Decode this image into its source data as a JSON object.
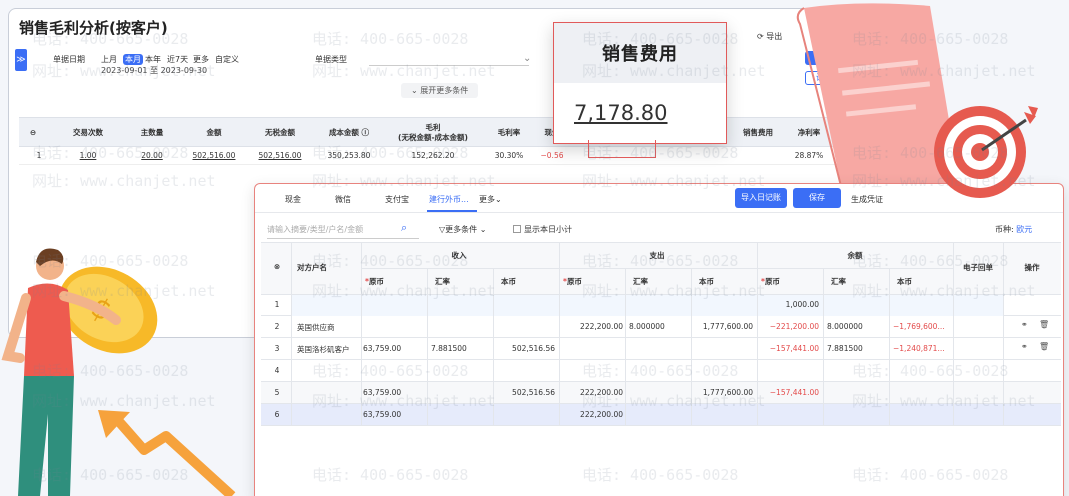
{
  "back_window": {
    "title": "销售毛利分析(按客户)",
    "side_tab": "≫",
    "filter_label": "单据日期",
    "date_chips": [
      "上月",
      "本月",
      "本年",
      "近7天",
      "更多",
      "自定义"
    ],
    "active_chip": "本月",
    "date_range": "2023-09-01 至 2023-09-30",
    "doc_type_label": "单据类型",
    "expand_label": "展开更多条件",
    "export_label": "导出",
    "btn_query": "查",
    "btn_setting": "设",
    "headers": [
      "交易次数",
      "主数量",
      "金额",
      "无税金额",
      "成本金额 ⓘ",
      "毛利\n(无税金额-成本金额)",
      "毛利率",
      "现金",
      "销售费用",
      "净利率"
    ],
    "row": {
      "index": "1",
      "count": "1.00",
      "qty": "20.00",
      "amount": "502,516.00",
      "notax": "502,516.00",
      "cost": "350,253.80",
      "profit": "152,262.20",
      "margin": "30.30%",
      "cash": "−0.56",
      "net_margin": "28.87%"
    }
  },
  "callout": {
    "title": "销售费用",
    "value": "7,178.80"
  },
  "front_window": {
    "tabs": [
      "现金",
      "微信",
      "支付宝",
      "建行外币...",
      "更多"
    ],
    "active_tab": "建行外币...",
    "btn_import": "导入日记账",
    "btn_save": "保存",
    "btn_generate": "生成凭证",
    "search_placeholder": "请输入摘要/类型/户名/金额",
    "more_conditions": "更多条件",
    "show_subtotal": "显示本日小计",
    "currency_label": "币种:",
    "currency_value": "欧元",
    "col_party": "对方户名",
    "group_income": "收入",
    "group_expense": "支出",
    "group_balance": "余额",
    "col_orig": "原币",
    "col_rate": "汇率",
    "col_local": "本币",
    "col_edoc": "电子回单",
    "col_action": "操作",
    "rows": [
      {
        "no": "1",
        "party": "",
        "in_orig": "",
        "in_rate": "",
        "in_local": "",
        "out_orig": "",
        "out_rate": "",
        "out_local": "",
        "bal_orig": "1,000.00",
        "bal_rate": "",
        "bal_local": ""
      },
      {
        "no": "2",
        "party": "英国供应商",
        "in_orig": "",
        "in_rate": "",
        "in_local": "",
        "out_orig": "222,200.00",
        "out_rate": "8.000000",
        "out_local": "1,777,600.00",
        "bal_orig": "−221,200.00",
        "bal_rate": "8.000000",
        "bal_local": "−1,769,600..."
      },
      {
        "no": "3",
        "party": "英国洛杉矶客户",
        "in_orig": "63,759.00",
        "in_rate": "7.881500",
        "in_local": "502,516.56",
        "out_orig": "",
        "out_rate": "",
        "out_local": "",
        "bal_orig": "−157,441.00",
        "bal_rate": "7.881500",
        "bal_local": "−1,240,871..."
      },
      {
        "no": "4",
        "party": "",
        "in_orig": "",
        "in_rate": "",
        "in_local": "",
        "out_orig": "",
        "out_rate": "",
        "out_local": "",
        "bal_orig": "",
        "bal_rate": "",
        "bal_local": ""
      },
      {
        "no": "5",
        "party": "",
        "in_orig": "63,759.00",
        "in_rate": "",
        "in_local": "502,516.56",
        "out_orig": "222,200.00",
        "out_rate": "",
        "out_local": "1,777,600.00",
        "bal_orig": "−157,441.00",
        "bal_rate": "",
        "bal_local": ""
      },
      {
        "no": "6",
        "party": "",
        "in_orig": "63,759.00",
        "in_rate": "",
        "in_local": "",
        "out_orig": "222,200.00",
        "out_rate": "",
        "out_local": "",
        "bal_orig": "",
        "bal_rate": "",
        "bal_local": ""
      }
    ]
  },
  "watermark": {
    "phone": "电话: 400-665-0028",
    "site": "网址: www.chanjet.net"
  },
  "colors": {
    "accent": "#3b6ef5",
    "negative": "#e34b4b",
    "highlight": "#e15a5a"
  }
}
